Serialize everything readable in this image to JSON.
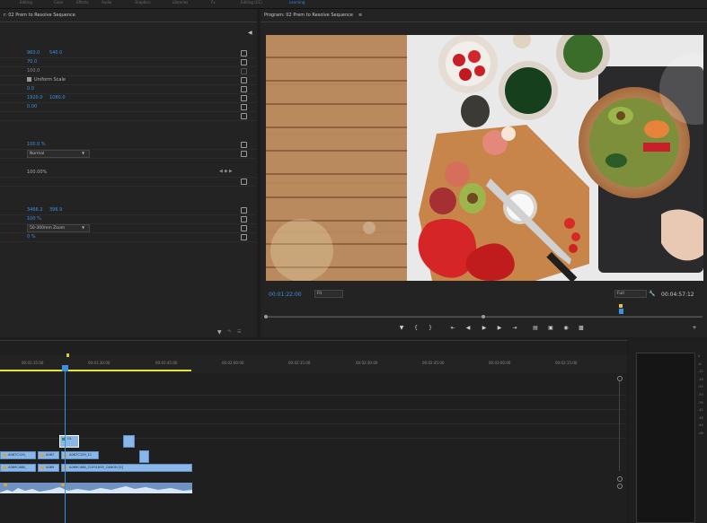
{
  "workspaces": [
    "Editing",
    "Color",
    "Effects",
    "Audio",
    "Graphics",
    "Libraries",
    "Fx",
    "Editing (CC)",
    "Learning"
  ],
  "effect_controls": {
    "title": "r: 02 Prem to Resolve Sequence",
    "rows": {
      "position": [
        "960.0",
        "540.0"
      ],
      "scale": "70.0",
      "scale_width": "100.0",
      "uniform_scale": "Uniform Scale",
      "rotation": "0.0",
      "anchor": [
        "1920.0",
        "1080.0"
      ],
      "antiflicker": "0.00",
      "opacity": "100.0 %",
      "blend_mode": "Normal",
      "time_remap": "100.00%",
      "lens_position": [
        "3466.2",
        "396.9"
      ],
      "lens_brightness": "100 %",
      "lens_type": "50-300mm Zoom",
      "blend_original": "0 %"
    }
  },
  "program": {
    "title": "Program: 02 Prem to Resolve Sequence",
    "timecode_current": "00:01:22:00",
    "fit": "Fit",
    "resolution": "Full",
    "timecode_total": "00:04:57:12"
  },
  "timeline": {
    "ruler": [
      "00:01:15:00",
      "00:01:30:00",
      "00:01:45:00",
      "00:02:00:00",
      "00:02:15:00",
      "00:02:30:00",
      "00:02:45:00",
      "00:03:00:00",
      "00:03:15:00"
    ],
    "clips": {
      "v3": "Gl.",
      "v1a": "A067C129_",
      "v1b": "A067",
      "v1c": "A067C129_11",
      "v0a": "A069C468_",
      "v0b": "A069",
      "v0c": "A069C468_21091695_CANON [V]"
    }
  },
  "audio_meter": {
    "db": [
      "0",
      "-6",
      "-12",
      "-18",
      "-24",
      "-30",
      "-36",
      "-42",
      "-48",
      "-54",
      "-dB"
    ]
  },
  "colors": {
    "accent": "#2d8ceb",
    "clip": "#8bb6e8",
    "playhead": "#3f8fe0"
  }
}
